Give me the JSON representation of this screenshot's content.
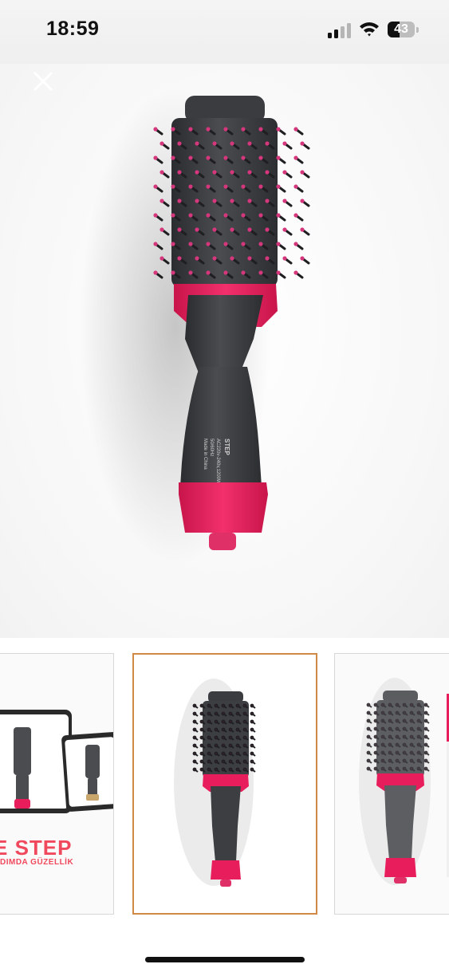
{
  "status_bar": {
    "time": "18:59",
    "battery_level": "43",
    "battery_fraction": 0.43,
    "signal_bars_filled": 2,
    "signal_bars_total": 4
  },
  "viewer": {
    "close_icon": "close-icon",
    "main_image": "hair-dryer-brush-front",
    "product_label_lines": [
      "STEP",
      "AC220v-240v,1200W",
      "50/60Hz",
      "Made in China"
    ]
  },
  "thumbnails": [
    {
      "name": "promo-thumbnail",
      "title": "E STEP",
      "subtitle": "DIMDA GÜZELLİK",
      "selected": false
    },
    {
      "name": "product-thumbnail",
      "selected": true
    },
    {
      "name": "product-thumbnail-alt",
      "selected": false
    }
  ],
  "colors": {
    "brush_body": "#3c3e41",
    "accent_pink": "#e81e5c",
    "bristle_tip": "#d4377c",
    "selected_border": "#d08a45"
  }
}
